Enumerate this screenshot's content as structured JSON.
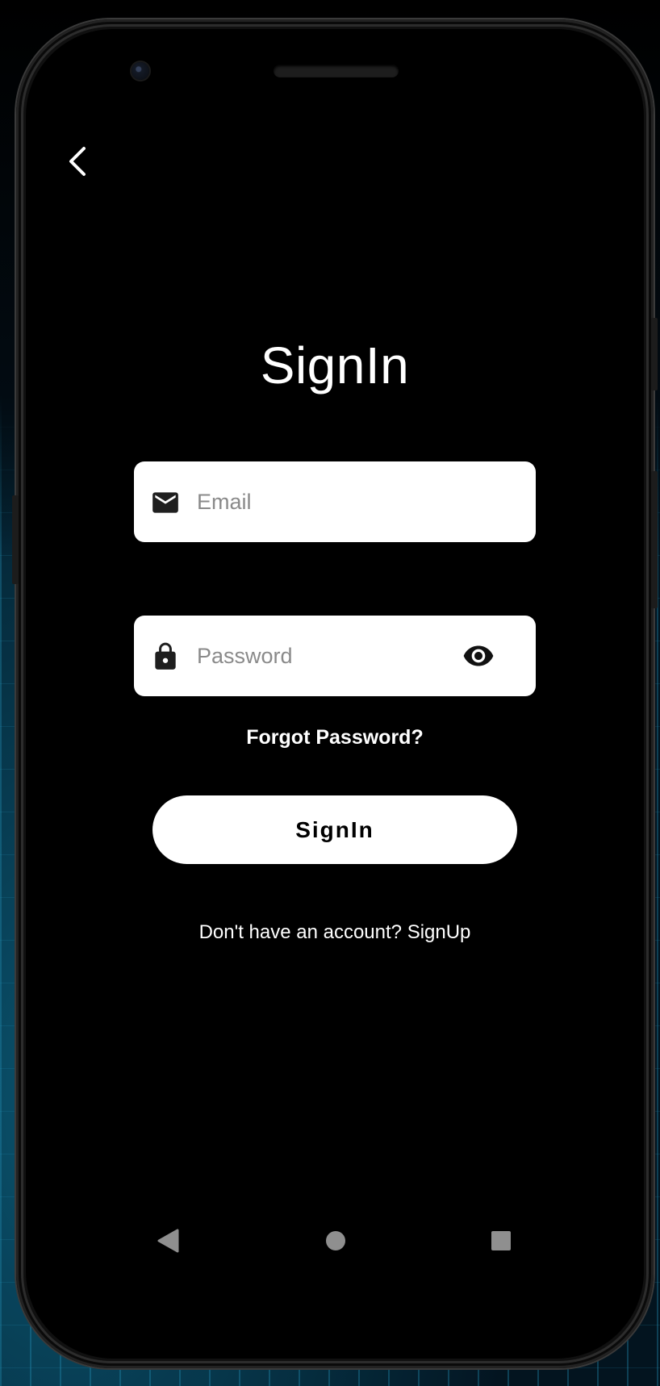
{
  "screen": {
    "back_icon": "chevron-left-icon",
    "title": "SignIn",
    "email": {
      "icon": "mail-icon",
      "placeholder": "Email",
      "value": ""
    },
    "password": {
      "icon": "lock-icon",
      "placeholder": "Password",
      "value": "",
      "toggle_icon": "eye-icon"
    },
    "forgot_password": "Forgot Password?",
    "signin_button": "SignIn",
    "signup_prompt": "Don't have an account?",
    "signup_link": "SignUp"
  },
  "navbar": {
    "back_icon": "nav-back-triangle-icon",
    "home_icon": "nav-home-circle-icon",
    "recent_icon": "nav-recents-square-icon"
  },
  "colors": {
    "background": "#000000",
    "text": "#ffffff",
    "field_background": "#ffffff",
    "placeholder": "#8a8a8a",
    "nav_icons": "#8f8f8f"
  }
}
